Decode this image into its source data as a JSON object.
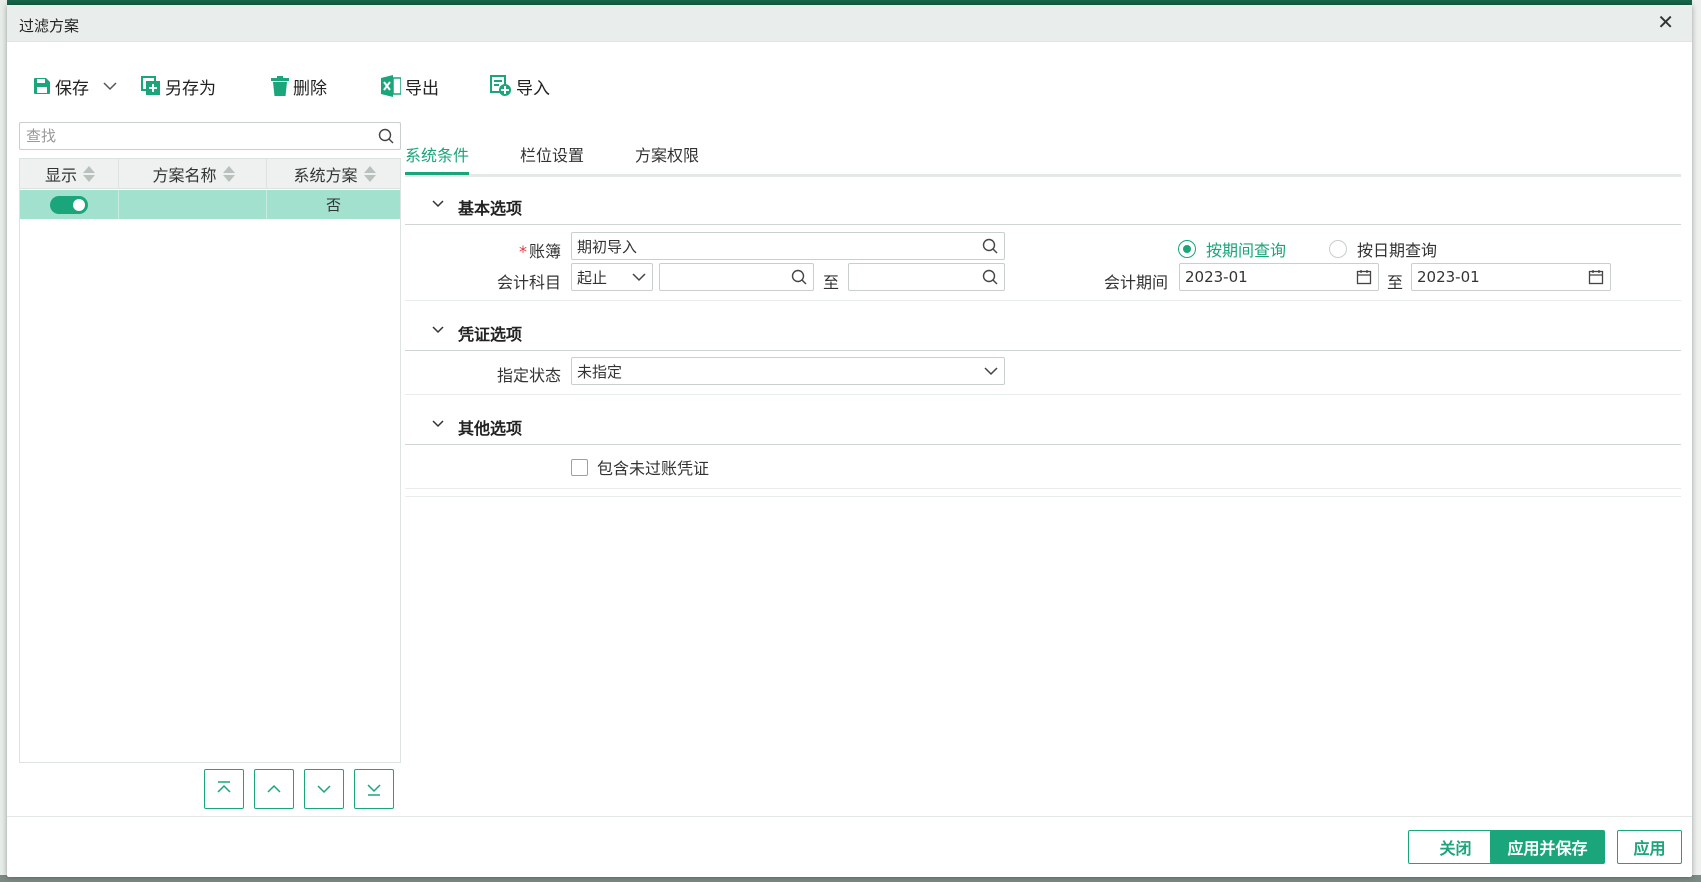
{
  "dialog": {
    "title": "过滤方案",
    "close_glyph": "✕"
  },
  "toolbar": {
    "save": "保存",
    "save_as": "另存为",
    "delete": "删除",
    "export": "导出",
    "import": "导入"
  },
  "scheme_list": {
    "search_placeholder": "查找",
    "columns": [
      "显示",
      "方案名称",
      "系统方案"
    ],
    "rows": [
      {
        "show": true,
        "name": "",
        "system": "否"
      }
    ]
  },
  "tabs": [
    "系统条件",
    "栏位设置",
    "方案权限"
  ],
  "sections": {
    "basic": {
      "title": "基本选项",
      "ledger_label": "账簿",
      "ledger_required_mark": "*",
      "ledger_value": "期初导入",
      "subject_label": "会计科目",
      "subject_mode": "起止",
      "subject_from": "",
      "subject_to": "",
      "to_word": "至",
      "query_by_period": "按期间查询",
      "query_by_date": "按日期查询",
      "period_label": "会计期间",
      "period_from": "2023-01",
      "period_to": "2023-01"
    },
    "voucher": {
      "title": "凭证选项",
      "status_label": "指定状态",
      "status_value": "未指定"
    },
    "other": {
      "title": "其他选项",
      "include_unposted": "包含未过账凭证"
    }
  },
  "footer": {
    "close": "关闭",
    "apply_save": "应用并保存",
    "apply": "应用"
  },
  "colors": {
    "accent": "#1aa57b",
    "selected_row": "#a2e1cd",
    "required": "#e0393e"
  }
}
